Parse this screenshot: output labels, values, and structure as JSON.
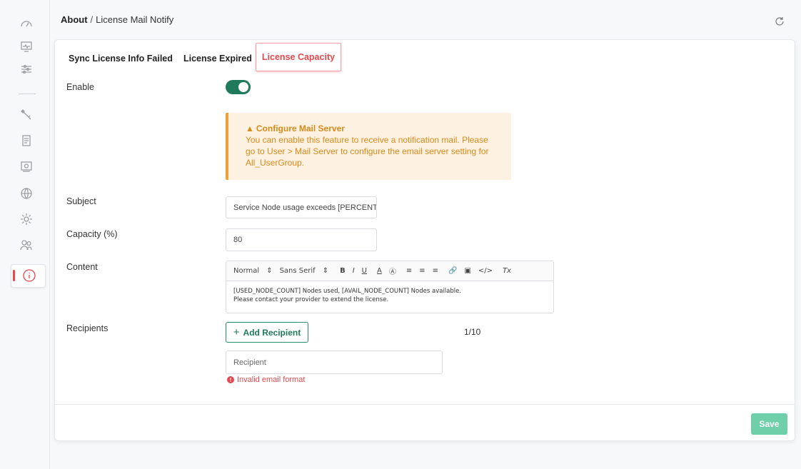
{
  "breadcrumb": {
    "root": "About",
    "separator": "/",
    "current": "License Mail Notify"
  },
  "tabs": [
    {
      "label": "Sync License Info Failed",
      "active": false
    },
    {
      "label": "License Expired",
      "active": false
    },
    {
      "label": "License Capacity",
      "active": true
    }
  ],
  "form": {
    "enable_label": "Enable",
    "enabled": true,
    "alert": {
      "title": "Configure Mail Server",
      "message": "You can enable this feature to receive a notification mail. Please go to User > Mail Server to configure the email server setting for All_UserGroup."
    },
    "subject_label": "Subject",
    "subject_value": "Service Node usage exceeds [PERCENT.",
    "capacity_label": "Capacity (%)",
    "capacity_value": "80",
    "content_label": "Content",
    "editor": {
      "toolbar": [
        "Normal",
        "Sans Serif",
        "B",
        "I",
        "U",
        "A",
        "Ⓐ",
        "≡",
        "≡",
        "≡",
        "🔗",
        "▣",
        "</>",
        "Tx"
      ],
      "header_value": "Normal",
      "font_value": "Sans Serif",
      "line1": "[USED_NODE_COUNT] Nodes used, [AVAIL_NODE_COUNT] Nodes available.",
      "line2": "Please contact your provider to extend the license."
    },
    "recipients_label": "Recipients",
    "add_recipient_label": "Add Recipient",
    "recipient_count": "1/10",
    "recipient_placeholder": "Recipient",
    "error_message": "Invalid email format"
  },
  "save_label": "Save",
  "colors": {
    "accent_green": "#1f7a5c",
    "active_red": "#e5484d",
    "warning_orange": "#d98a1a",
    "save_green": "#6fcfa8"
  },
  "sidebar": {
    "icons": [
      "dashboard-icon",
      "monitor-icon",
      "sliders-icon",
      "wrench-icon",
      "document-icon",
      "license-icon",
      "globe-icon",
      "gear-icon",
      "users-icon",
      "info-icon"
    ],
    "active": "info-icon"
  }
}
